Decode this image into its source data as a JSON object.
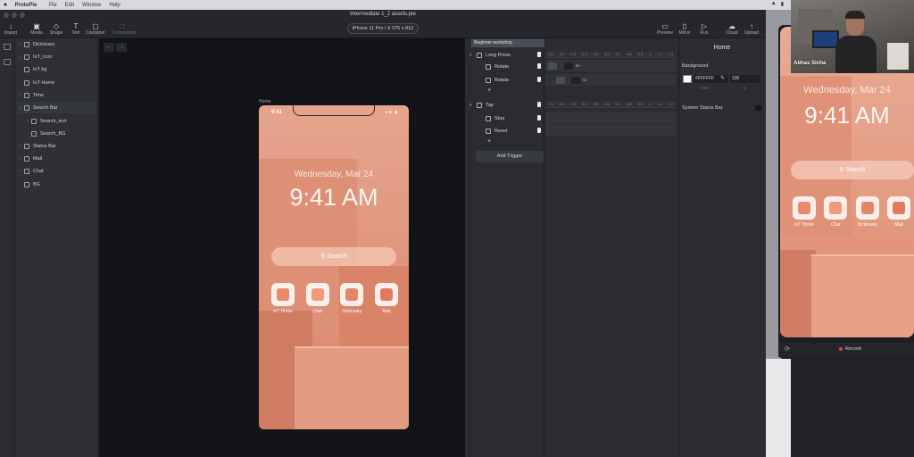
{
  "menubar": {
    "items": [
      "ProtoPie",
      "Pie",
      "Edit",
      "Window",
      "Help"
    ]
  },
  "window": {
    "title": "Intermediate 1_2 assets.pie",
    "device": "iPhone 11 Pro / X  375 x 812"
  },
  "toolbar": {
    "import": "Import",
    "media": "Media",
    "shape": "Shape",
    "text": "Text",
    "container": "Container",
    "component": "Component",
    "preview": "Preview",
    "mirror": "Mirror",
    "run": "Run",
    "cloud": "Cloud",
    "upload": "Upload"
  },
  "layers": [
    {
      "name": "Dictionary",
      "expandable": true
    },
    {
      "name": "IoT_Icon",
      "expandable": true
    },
    {
      "name": "IoT bg",
      "expandable": false
    },
    {
      "name": "IoT Home",
      "expandable": false
    },
    {
      "name": "Time",
      "expandable": true
    },
    {
      "name": "Search Bar",
      "expandable": true
    },
    {
      "name": "Search_text",
      "expandable": true
    },
    {
      "name": "Search_BG",
      "expandable": false
    },
    {
      "name": "Status Bar",
      "expandable": true
    },
    {
      "name": "Mail",
      "expandable": true
    },
    {
      "name": "Chat",
      "expandable": true
    },
    {
      "name": "BG",
      "expandable": false
    }
  ],
  "canvas": {
    "artboard_label": "Home",
    "phone": {
      "status_time": "9:41",
      "date": "Wednesday, Mar 24",
      "time": "9:41 AM",
      "search": "Search",
      "apps": [
        {
          "label": "IoT Home",
          "color": "#e98a6d"
        },
        {
          "label": "Chat",
          "color": "#ef9a7e"
        },
        {
          "label": "Dictionary",
          "color": "#e2866a"
        },
        {
          "label": "Mail",
          "color": "#e27a62"
        }
      ]
    }
  },
  "patch": {
    "title": "Beginner workshop",
    "triggers": [
      {
        "name": "Long Press",
        "responses": [
          "Rotate",
          "Rotate"
        ]
      },
      {
        "name": "Tap",
        "responses": [
          "Stop",
          "Reset"
        ]
      }
    ],
    "add_trigger": "Add Trigger",
    "ruler": [
      "0.1",
      "0.2",
      "0.3",
      "0.4",
      "0.5",
      "0.6",
      "0.7",
      "0.8",
      "0.9",
      "1",
      "1.1",
      "1.2"
    ],
    "key_labels": [
      "ke",
      "ke"
    ]
  },
  "inspector": {
    "title": "Home",
    "background_label": "Background",
    "hex": "#FFFFFF",
    "opacity": "100",
    "hex_caption": "HEX",
    "opacity_caption": "%",
    "status_bar_label": "System Status Bar"
  },
  "preview": {
    "date": "Wednesday, Mar 24",
    "time": "9:41 AM",
    "search": "Search",
    "record": "Record"
  },
  "webcam": {
    "name": "Abhas Sinha"
  }
}
